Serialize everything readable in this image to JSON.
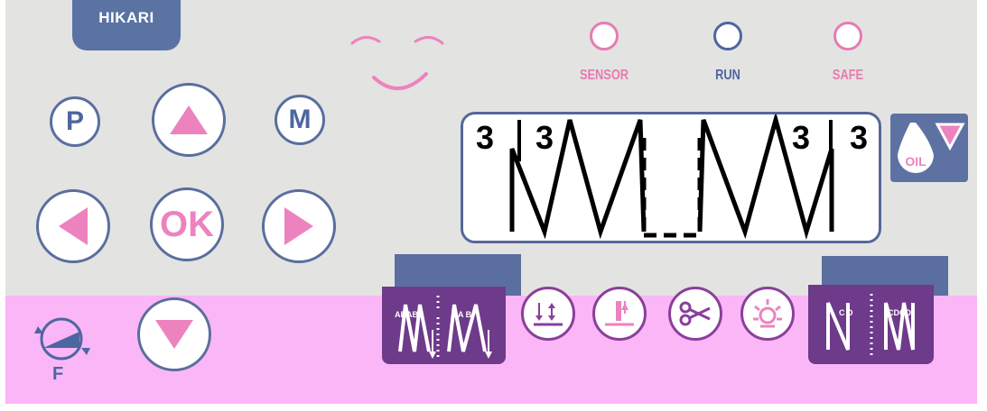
{
  "brand": {
    "name": "HIKARI"
  },
  "indicators": [
    {
      "label": "SENSOR",
      "color": "#e77bb2"
    },
    {
      "label": "RUN",
      "color": "#4e66a0"
    },
    {
      "label": "SAFE",
      "color": "#e77bb2"
    }
  ],
  "buttons": {
    "p_label": "P",
    "m_label": "M",
    "ok_label": "OK",
    "f_label": "F",
    "oil_label": "OIL"
  },
  "lcd": {
    "left_outer": "3",
    "left_inner": "3",
    "right_inner": "3",
    "right_outer": "3"
  },
  "stitch_keys": {
    "start_a": "ABAB",
    "start_b": "A B",
    "end_a": "C D",
    "end_b": "CDCD"
  },
  "colors": {
    "panel": "#e3e3e1",
    "accent_blue": "#5a6e9e",
    "accent_pink": "#ec83bf",
    "overlay_pink": "#fbb6f8"
  }
}
